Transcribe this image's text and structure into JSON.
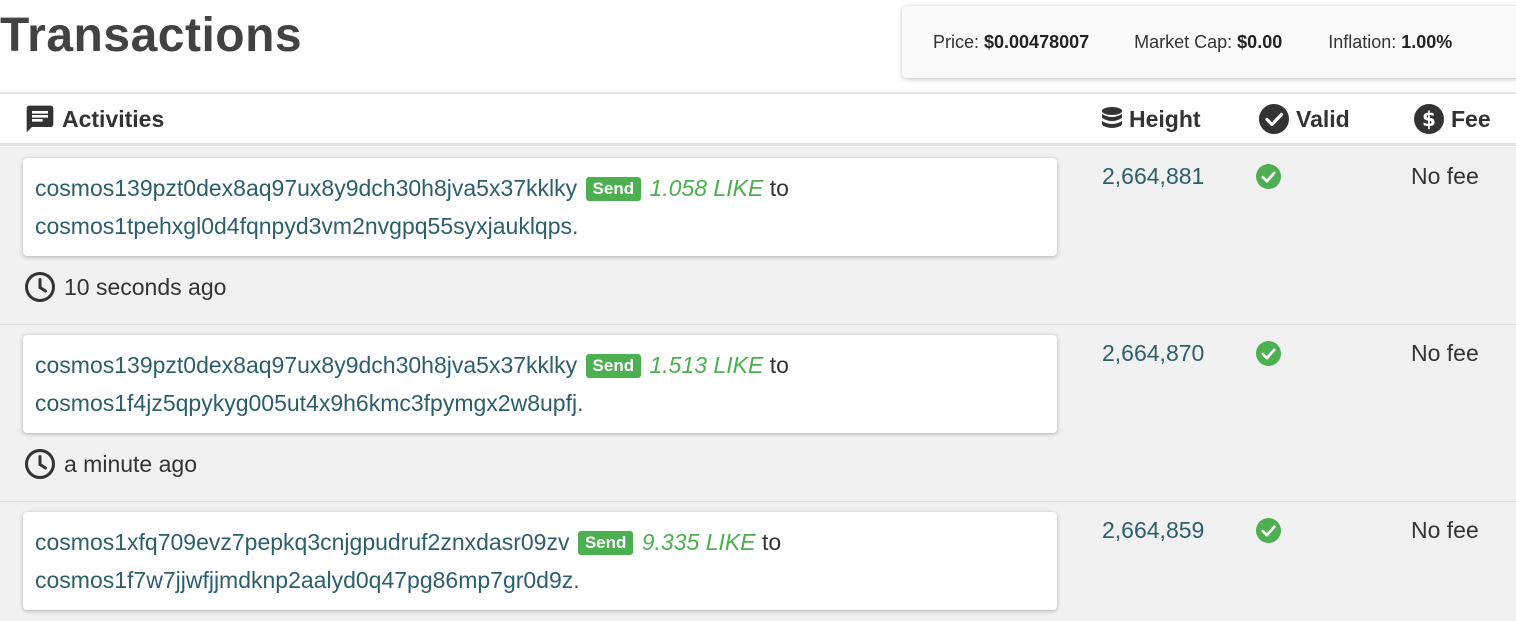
{
  "page": {
    "title": "Transactions"
  },
  "stats": {
    "price_label": "Price: ",
    "price_value": "$0.00478007",
    "market_cap_label": "Market Cap: ",
    "market_cap_value": "$0.00",
    "inflation_label": "Inflation: ",
    "inflation_value": "1.00%"
  },
  "table": {
    "headers": {
      "activities": "Activities",
      "height": "Height",
      "valid": "Valid",
      "fee": "Fee"
    }
  },
  "colors": {
    "accent_green": "#4caf50",
    "link_teal": "#2b5f6b",
    "row_bg": "#f1f1f1"
  },
  "transactions": [
    {
      "from": "cosmos139pzt0dex8aq97ux8y9dch30h8jva5x37kklky",
      "badge": "Send",
      "amount": "1.058 LIKE",
      "to_word": "to",
      "to": "cosmos1tpehxgl0d4fqnpyd3vm2nvgpq55syxjauklqps",
      "period": ".",
      "time": "10 seconds ago",
      "height": "2,664,881",
      "fee": "No fee"
    },
    {
      "from": "cosmos139pzt0dex8aq97ux8y9dch30h8jva5x37kklky",
      "badge": "Send",
      "amount": "1.513 LIKE",
      "to_word": "to",
      "to": "cosmos1f4jz5qpykyg005ut4x9h6kmc3fpymgx2w8upfj",
      "period": ".",
      "time": "a minute ago",
      "height": "2,664,870",
      "fee": "No fee"
    },
    {
      "from": "cosmos1xfq709evz7pepkq3cnjgpudruf2znxdasr09zv",
      "badge": "Send",
      "amount": "9.335 LIKE",
      "to_word": "to",
      "to": "cosmos1f7w7jjwfjjmdknp2aalyd0q47pg86mp7gr0d9z",
      "period": ".",
      "time": "",
      "height": "2,664,859",
      "fee": "No fee"
    }
  ]
}
